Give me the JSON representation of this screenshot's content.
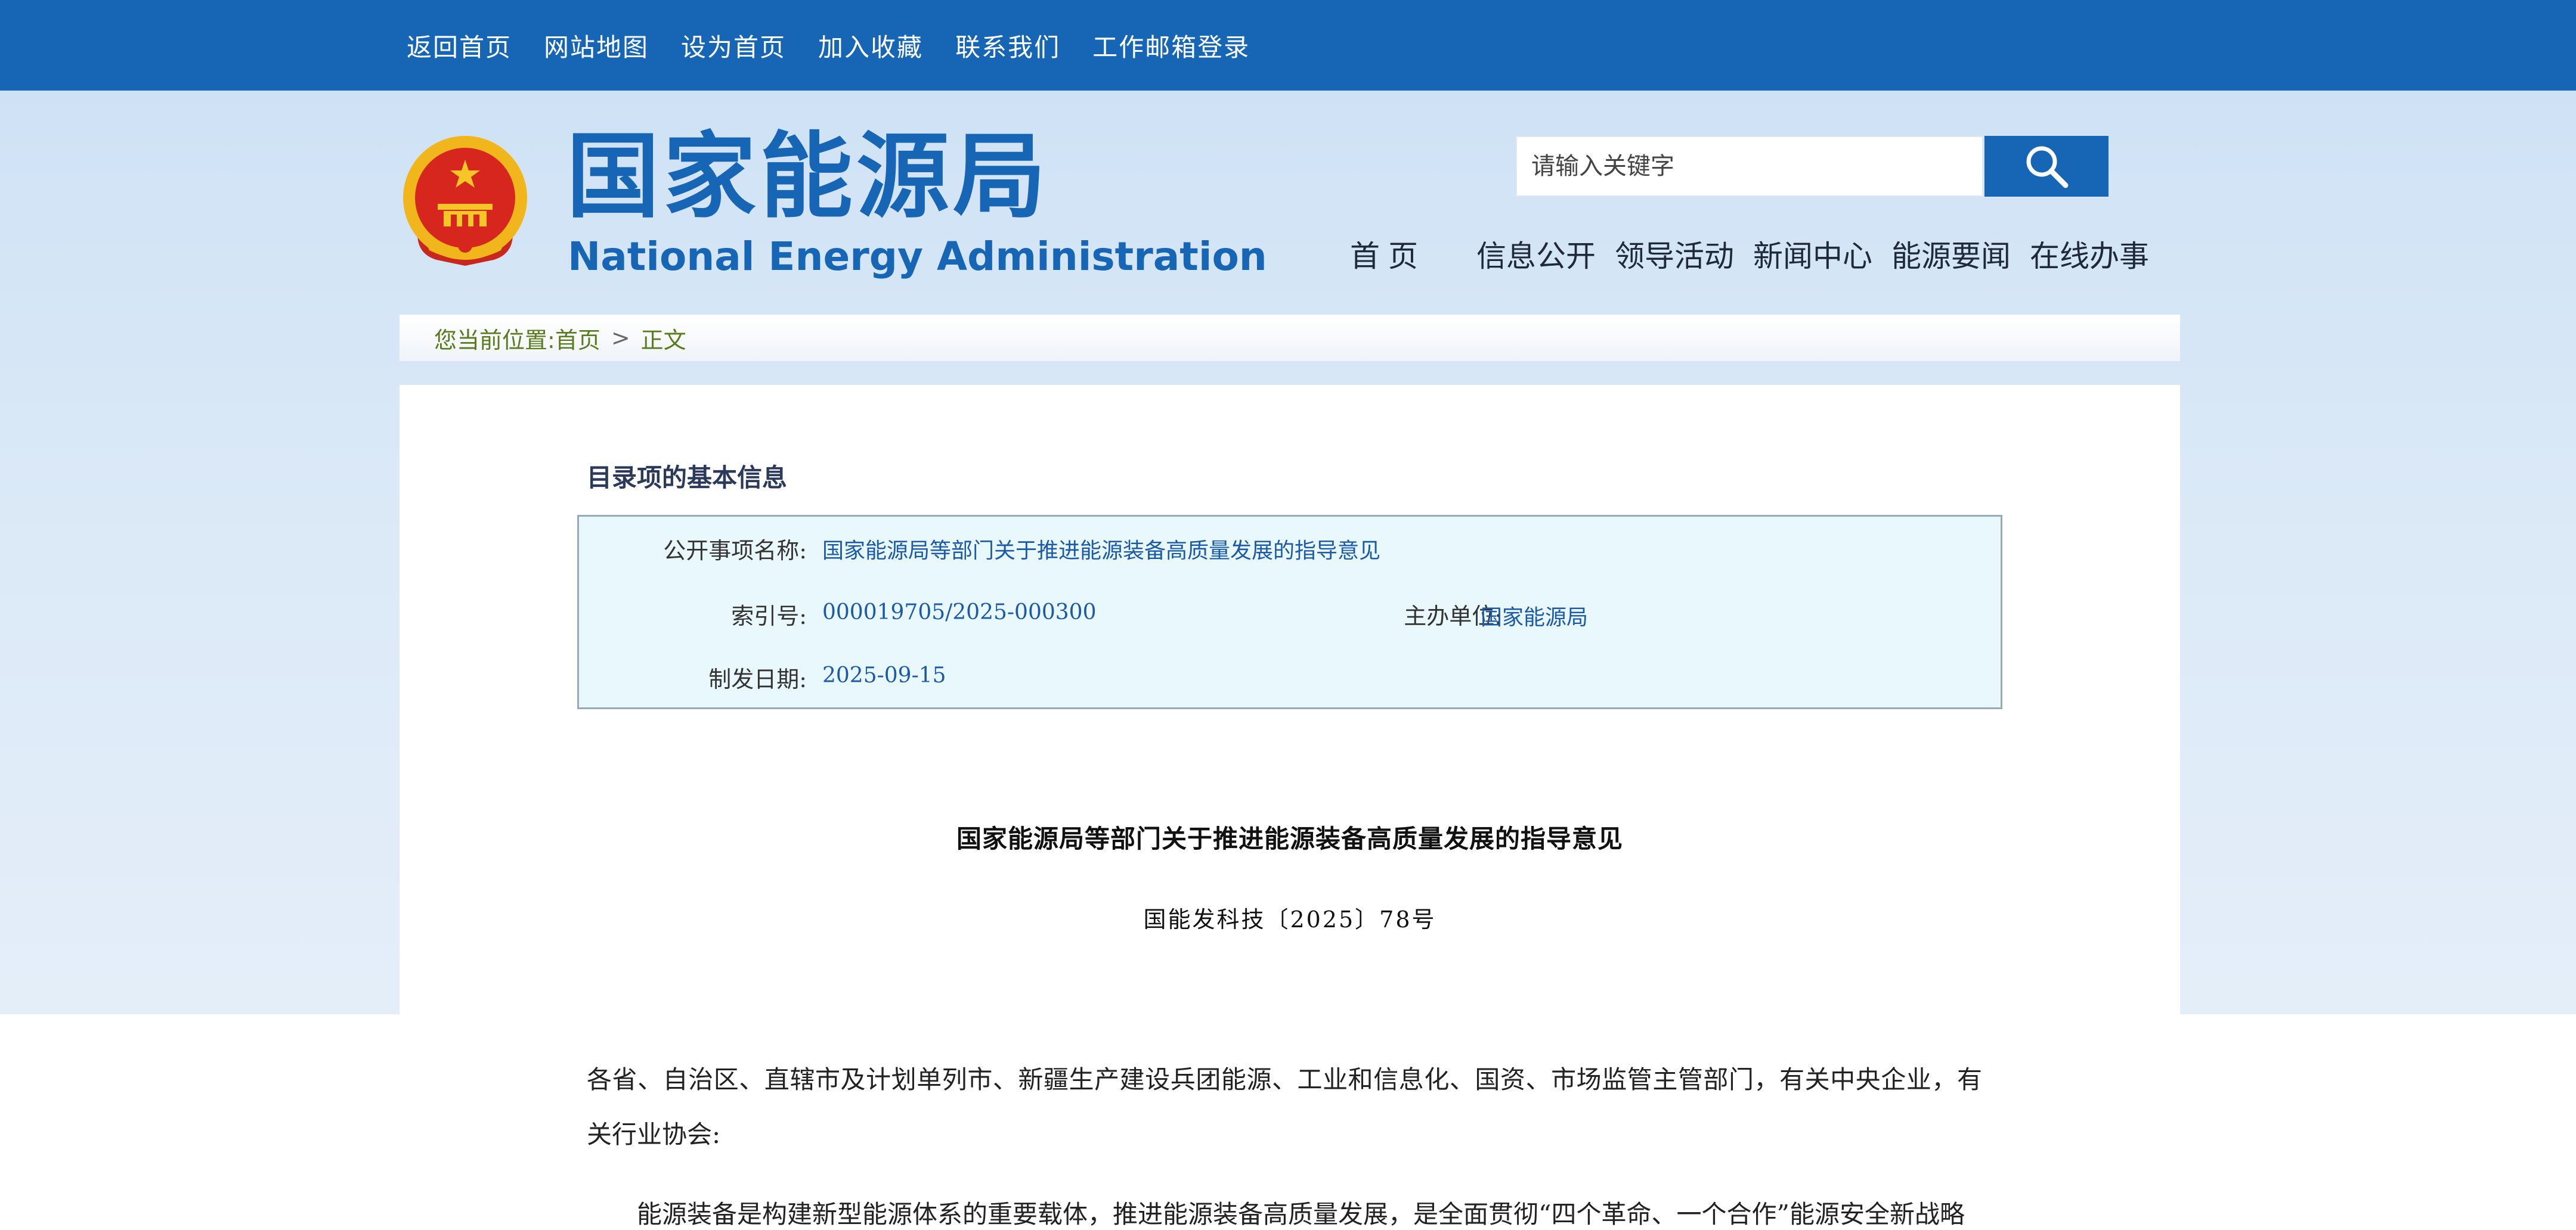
{
  "topbar": {
    "links": [
      "返回首页",
      "网站地图",
      "设为首页",
      "加入收藏",
      "联系我们",
      "工作邮箱登录"
    ]
  },
  "header": {
    "logo_cn": "国家能源局",
    "logo_en": "National Energy Administration",
    "search_placeholder": "请输入关键字",
    "nav": [
      "首页",
      "信息公开",
      "领导活动",
      "新闻中心",
      "能源要闻",
      "在线办事"
    ]
  },
  "breadcrumb": {
    "label": "您当前位置:",
    "home": "首页",
    "separator": ">",
    "current": "正文"
  },
  "catalog": {
    "title": "目录项的基本信息",
    "name_label": "公开事项名称:",
    "name_value": "国家能源局等部门关于推进能源装备高质量发展的指导意见",
    "index_label": "索引号:",
    "index_value": "000019705/2025-000300",
    "unit_label": "主办单位:",
    "unit_value": "国家能源局",
    "date_label": "制发日期:",
    "date_value": "2025-09-15"
  },
  "document": {
    "title": "国家能源局等部门关于推进能源装备高质量发展的指导意见",
    "number": "国能发科技〔2025〕78号",
    "para1": "各省、自治区、直辖市及计划单列市、新疆生产建设兵团能源、工业和信息化、国资、市场监管主管部门，有关中央企业，有关行业协会:",
    "para2": "能源装备是构建新型能源体系的重要载体，推进能源装备高质量发展，是全面贯彻“四个革命、一个合作”能源安全新战略"
  },
  "colors": {
    "brand_blue": "#1766b5",
    "background": "#d7e7f6",
    "info_box_bg": "#e8f8fc",
    "link_blue": "#1a5aa8"
  },
  "icons": {
    "search": "magnifier-icon",
    "emblem": "national-emblem-icon"
  }
}
